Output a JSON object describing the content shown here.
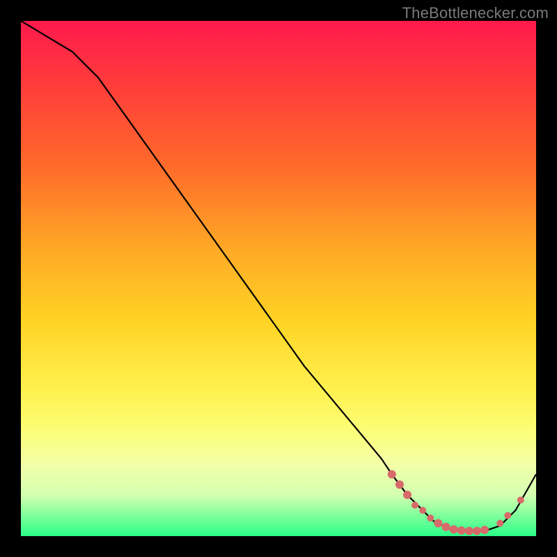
{
  "attribution": "TheBottlenecker.com",
  "chart_data": {
    "type": "line",
    "title": "",
    "xlabel": "",
    "ylabel": "",
    "xlim": [
      0,
      100
    ],
    "ylim": [
      0,
      100
    ],
    "series": [
      {
        "name": "curve",
        "x": [
          0,
          5,
          10,
          15,
          20,
          25,
          30,
          35,
          40,
          45,
          50,
          55,
          60,
          65,
          70,
          72,
          75,
          78,
          80,
          83,
          86,
          90,
          93,
          96,
          100
        ],
        "y": [
          100,
          97,
          94,
          89,
          82,
          75,
          68,
          61,
          54,
          47,
          40,
          33,
          27,
          21,
          15,
          12,
          8,
          5,
          3,
          1.5,
          1,
          1,
          2,
          5,
          12
        ]
      }
    ],
    "markers": [
      {
        "x": 72,
        "y": 12,
        "r": 6
      },
      {
        "x": 73.5,
        "y": 10,
        "r": 6
      },
      {
        "x": 75,
        "y": 8,
        "r": 6
      },
      {
        "x": 76.5,
        "y": 6,
        "r": 5
      },
      {
        "x": 78,
        "y": 5,
        "r": 5
      },
      {
        "x": 79.5,
        "y": 3.5,
        "r": 5
      },
      {
        "x": 81,
        "y": 2.5,
        "r": 6
      },
      {
        "x": 82.5,
        "y": 1.8,
        "r": 6
      },
      {
        "x": 84,
        "y": 1.3,
        "r": 6
      },
      {
        "x": 85.5,
        "y": 1.1,
        "r": 6
      },
      {
        "x": 87,
        "y": 1,
        "r": 6
      },
      {
        "x": 88.5,
        "y": 1,
        "r": 6
      },
      {
        "x": 90,
        "y": 1.2,
        "r": 6
      },
      {
        "x": 93,
        "y": 2.5,
        "r": 5
      },
      {
        "x": 94.5,
        "y": 4,
        "r": 5
      },
      {
        "x": 97,
        "y": 7,
        "r": 5
      }
    ],
    "marker_color": "#d86a6a",
    "line_color": "#000000"
  }
}
